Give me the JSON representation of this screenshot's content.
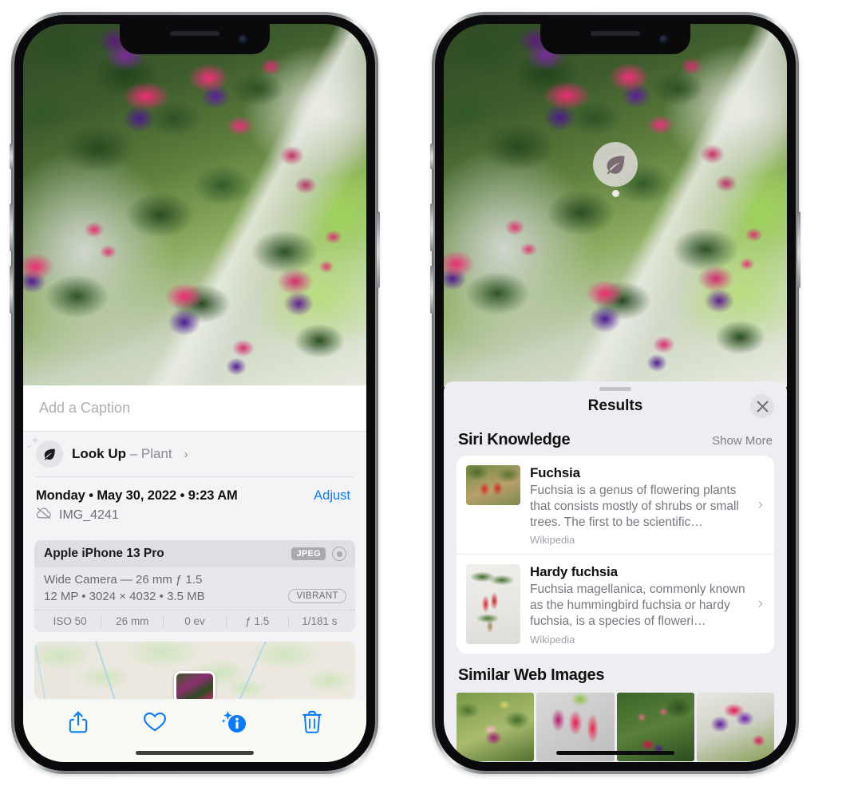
{
  "left_phone": {
    "caption": {
      "placeholder": "Add a Caption",
      "value": ""
    },
    "look_up": {
      "icon": "leaf-icon",
      "label": "Look Up",
      "dash": " – ",
      "subject": "Plant",
      "chevron": "›"
    },
    "date": {
      "text": "Monday • May 30, 2022 • 9:23 AM",
      "adjust_label": "Adjust"
    },
    "file": {
      "icon": "cloud-slash-icon",
      "name": "IMG_4241"
    },
    "camera_card": {
      "device": "Apple iPhone 13 Pro",
      "format_badge": "JPEG",
      "hdr_icon": "aperture-icon",
      "lens_line": "Wide Camera — 26 mm ƒ 1.5",
      "size_line": "12 MP • 3024 × 4032 • 3.5 MB",
      "color_badge": "VIBRANT",
      "exif": [
        "ISO 50",
        "26 mm",
        "0 ev",
        "ƒ 1.5",
        "1/181 s"
      ]
    },
    "map": {
      "pin": "photo-pin"
    },
    "toolbar": [
      {
        "name": "share-button",
        "icon": "share-icon"
      },
      {
        "name": "favorite-button",
        "icon": "heart-icon"
      },
      {
        "name": "info-button",
        "icon": "info-sparkle-icon"
      },
      {
        "name": "delete-button",
        "icon": "trash-icon"
      }
    ]
  },
  "right_phone": {
    "visual_lookup_pin": {
      "icon": "leaf-icon"
    },
    "sheet": {
      "title": "Results",
      "close_icon": "close-icon",
      "sections": [
        {
          "title": "Siri Knowledge",
          "action": "Show More",
          "items": [
            {
              "title": "Fuchsia",
              "description": "Fuchsia is a genus of flowering plants that consists mostly of shrubs or small trees. The first to be scientific…",
              "source": "Wikipedia",
              "thumbnail": "fuchsia-red-flowers-thumb",
              "chevron": "›"
            },
            {
              "title": "Hardy fuchsia",
              "description": "Fuchsia magellanica, commonly known as the hummingbird fuchsia or hardy fuchsia, is a species of floweri…",
              "source": "Wikipedia",
              "thumbnail": "hardy-fuchsia-branch-thumb",
              "chevron": "›"
            }
          ]
        },
        {
          "title": "Similar Web Images",
          "images": [
            "fuchsia-magenta-white-bloom",
            "fuchsia-red-pink-closeup",
            "fuchsia-bush-buds",
            "fuchsia-purple-red-cluster"
          ]
        }
      ]
    }
  },
  "colors": {
    "accent_blue": "#0a7bff",
    "sheet_bg": "#eeeef2",
    "panel_bg": "#f4f4f6",
    "card_bg": "#e8e8ec",
    "muted_text": "#77777f"
  }
}
